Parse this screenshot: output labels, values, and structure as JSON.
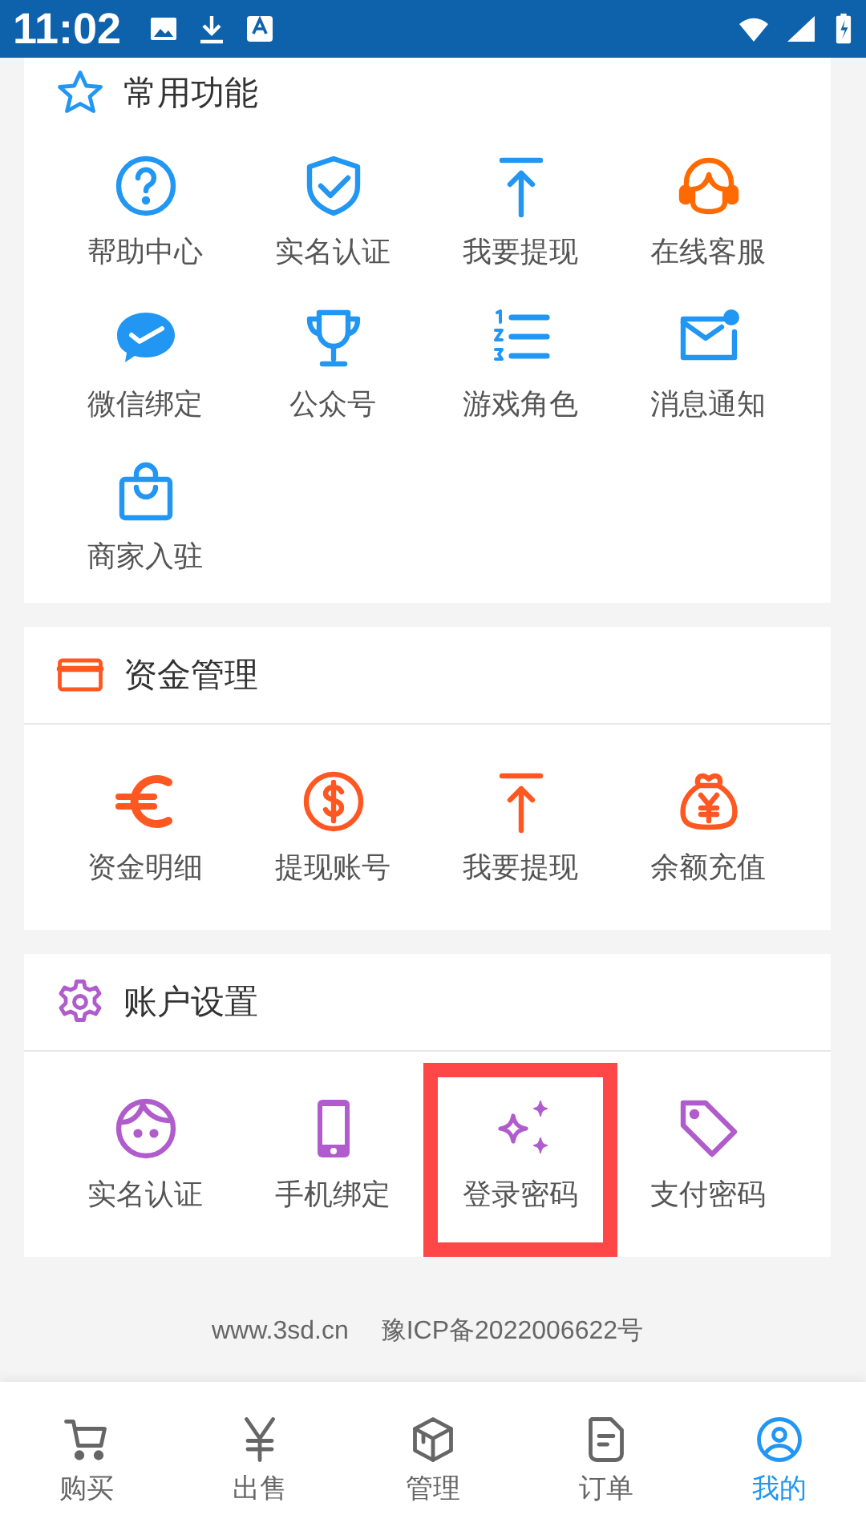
{
  "status_bar": {
    "time": "11:02"
  },
  "sections": [
    {
      "title": "常用功能",
      "items": [
        {
          "label": "帮助中心",
          "highlighted": false
        },
        {
          "label": "实名认证",
          "highlighted": false
        },
        {
          "label": "我要提现",
          "highlighted": false
        },
        {
          "label": "在线客服",
          "highlighted": false
        },
        {
          "label": "微信绑定",
          "highlighted": false
        },
        {
          "label": "公众号",
          "highlighted": false
        },
        {
          "label": "游戏角色",
          "highlighted": false
        },
        {
          "label": "消息通知",
          "highlighted": false
        },
        {
          "label": "商家入驻",
          "highlighted": false
        }
      ]
    },
    {
      "title": "资金管理",
      "items": [
        {
          "label": "资金明细",
          "highlighted": false
        },
        {
          "label": "提现账号",
          "highlighted": false
        },
        {
          "label": "我要提现",
          "highlighted": false
        },
        {
          "label": "余额充值",
          "highlighted": false
        }
      ]
    },
    {
      "title": "账户设置",
      "items": [
        {
          "label": "实名认证",
          "highlighted": false
        },
        {
          "label": "手机绑定",
          "highlighted": false
        },
        {
          "label": "登录密码",
          "highlighted": true
        },
        {
          "label": "支付密码",
          "highlighted": false
        }
      ]
    }
  ],
  "footer": {
    "site": "www.3sd.cn",
    "icp": "豫ICP备2022006622号"
  },
  "bottom_nav": [
    {
      "label": "购买",
      "selected": false
    },
    {
      "label": "出售",
      "selected": false
    },
    {
      "label": "管理",
      "selected": false
    },
    {
      "label": "订单",
      "selected": false
    },
    {
      "label": "我的",
      "selected": true
    }
  ]
}
